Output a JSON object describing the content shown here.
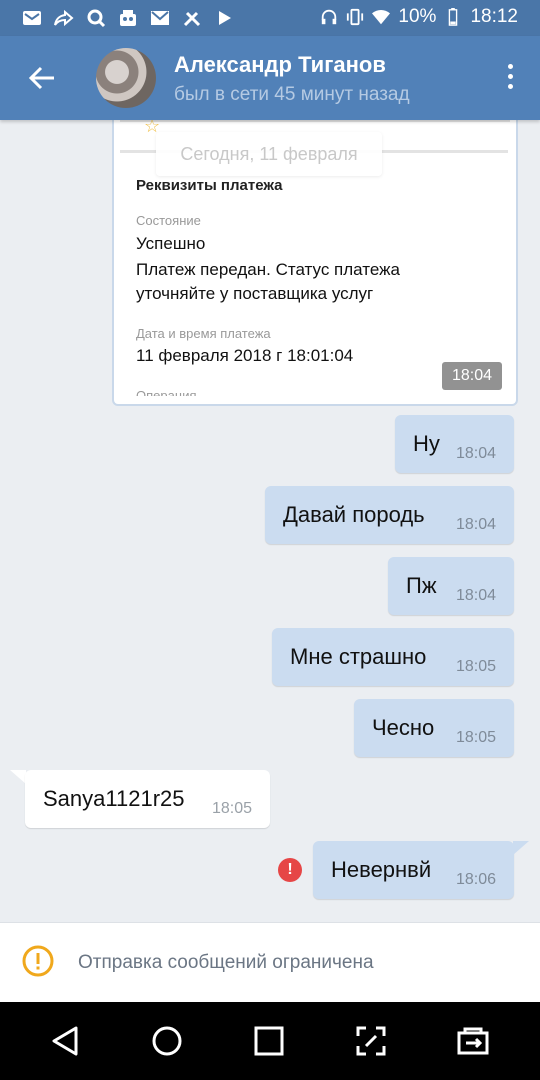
{
  "status_bar": {
    "battery": "10%",
    "time": "18:12",
    "left_icons": [
      "email-icon",
      "share-icon",
      "search-app-icon",
      "robot-icon",
      "gmail-icon",
      "tools-icon",
      "play-icon"
    ],
    "right_icons": [
      "headphones-icon",
      "vibrate-icon",
      "wifi-icon",
      "battery-icon"
    ]
  },
  "header": {
    "name": "Александр Тиганов",
    "status": "был в сети 45 минут назад"
  },
  "date_separator": "Сегодня, 11 февраля",
  "payment_card": {
    "title": "Реквизиты платежа",
    "state_label": "Состояние",
    "state_value": "Успешно",
    "state_note_1": "Платеж передан. Статус платежа",
    "state_note_2": "уточняйте у поставщика услуг",
    "datetime_label": "Дата и время платежа",
    "datetime_value": "11 февраля 2018 г 18:01:04",
    "operation_label": "Операция",
    "time": "18:04"
  },
  "messages": [
    {
      "text": "Ну",
      "time": "18:04",
      "direction": "out"
    },
    {
      "text": "Давай породь",
      "time": "18:04",
      "direction": "out"
    },
    {
      "text": "Пж",
      "time": "18:04",
      "direction": "out"
    },
    {
      "text": "Мне страшно",
      "time": "18:05",
      "direction": "out"
    },
    {
      "text": "Чесно",
      "time": "18:05",
      "direction": "out"
    },
    {
      "text": "Sanya1121r25",
      "time": "18:05",
      "direction": "in"
    },
    {
      "text": "Невернвй",
      "time": "18:06",
      "direction": "out",
      "error": true
    }
  ],
  "restriction": {
    "text": "Отправка сообщений ограничена"
  },
  "colors": {
    "header": "#5181b8",
    "outgoing_bubble": "#cbdcf0",
    "incoming_bubble": "#ffffff",
    "background": "#ebeef2",
    "error": "#e64646",
    "warning": "#f0a81c"
  }
}
